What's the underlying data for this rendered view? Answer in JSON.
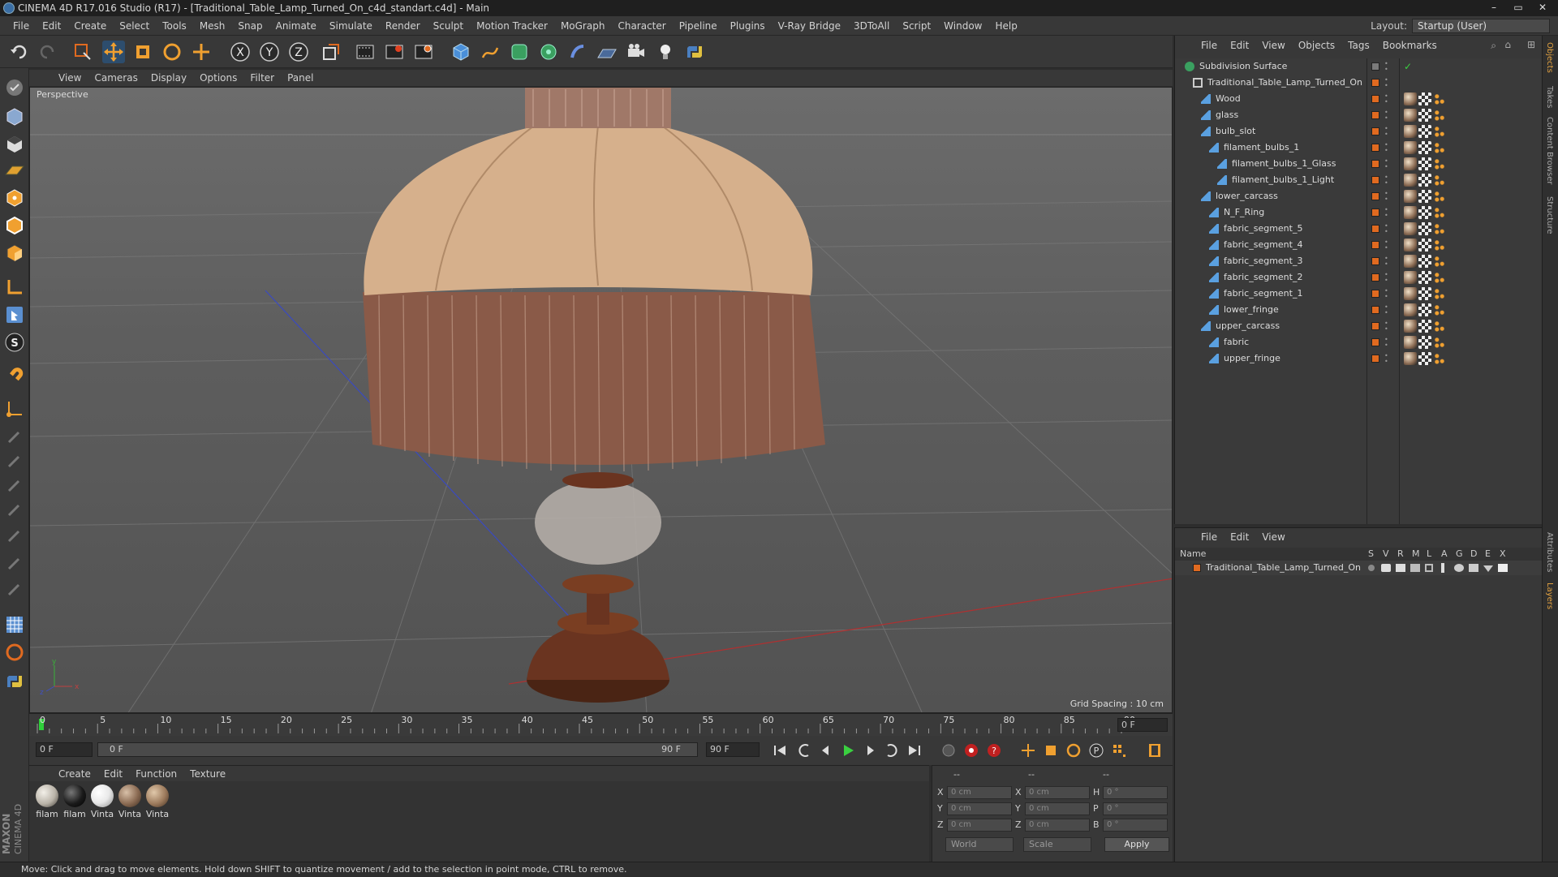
{
  "window": {
    "title": "CINEMA 4D R17.016 Studio (R17) - [Traditional_Table_Lamp_Turned_On_c4d_standart.c4d] - Main",
    "controls": [
      "–",
      "▭",
      "✕"
    ]
  },
  "menubar": {
    "items": [
      "File",
      "Edit",
      "Create",
      "Select",
      "Tools",
      "Mesh",
      "Snap",
      "Animate",
      "Simulate",
      "Render",
      "Sculpt",
      "Motion Tracker",
      "MoGraph",
      "Character",
      "Pipeline",
      "Plugins",
      "V-Ray Bridge",
      "3DToAll",
      "Script",
      "Window",
      "Help"
    ],
    "layout_label": "Layout:",
    "layout_value": "Startup (User)"
  },
  "toolbar": {
    "axis_x": "X",
    "axis_y": "Y",
    "axis_z": "Z"
  },
  "viewport": {
    "menu": [
      "View",
      "Cameras",
      "Display",
      "Options",
      "Filter",
      "Panel"
    ],
    "label": "Perspective",
    "grid_spacing": "Grid Spacing : 10 cm",
    "axis_y": "y",
    "axis_x": "x",
    "axis_z": "z"
  },
  "timeline": {
    "ticks": [
      "0",
      "5",
      "10",
      "15",
      "20",
      "25",
      "30",
      "35",
      "40",
      "45",
      "50",
      "55",
      "60",
      "65",
      "70",
      "75",
      "80",
      "85",
      "90"
    ],
    "current_frame_box": "0 F",
    "start_field": "0 F",
    "range_start": "0 F",
    "range_end": "90 F",
    "end_field": "90 F"
  },
  "material_manager": {
    "menu": [
      "Create",
      "Edit",
      "Function",
      "Texture"
    ],
    "materials": [
      {
        "label": "filam",
        "color": "#b9b3a8"
      },
      {
        "label": "filam",
        "color": "#1a1a1a"
      },
      {
        "label": "Vinta",
        "color": "#e8e8e8"
      },
      {
        "label": "Vinta",
        "color": "#8a6a52"
      },
      {
        "label": "Vinta",
        "color": "#9c7a5c"
      }
    ]
  },
  "coordinates": {
    "header": [
      "--",
      "--",
      "--"
    ],
    "rows": [
      {
        "a": "X",
        "av": "0 cm",
        "b": "X",
        "bv": "0 cm",
        "c": "H",
        "cv": "0 °"
      },
      {
        "a": "Y",
        "av": "0 cm",
        "b": "Y",
        "bv": "0 cm",
        "c": "P",
        "cv": "0 °"
      },
      {
        "a": "Z",
        "av": "0 cm",
        "b": "Z",
        "bv": "0 cm",
        "c": "B",
        "cv": "0 °"
      }
    ],
    "space": "World",
    "mode": "Scale",
    "apply": "Apply"
  },
  "status": "Move: Click and drag to move elements. Hold down SHIFT to quantize movement / add to the selection in point mode, CTRL to remove.",
  "object_manager": {
    "menu": [
      "File",
      "Edit",
      "View",
      "Objects",
      "Tags",
      "Bookmarks"
    ],
    "objects": [
      {
        "name": "Subdivision Surface",
        "depth": 0
      },
      {
        "name": "Traditional_Table_Lamp_Turned_On",
        "depth": 1
      },
      {
        "name": "Wood",
        "depth": 2
      },
      {
        "name": "glass",
        "depth": 2
      },
      {
        "name": "bulb_slot",
        "depth": 2
      },
      {
        "name": "filament_bulbs_1",
        "depth": 3
      },
      {
        "name": "filament_bulbs_1_Glass",
        "depth": 4
      },
      {
        "name": "filament_bulbs_1_Light",
        "depth": 4
      },
      {
        "name": "lower_carcass",
        "depth": 2
      },
      {
        "name": "N_F_Ring",
        "depth": 3
      },
      {
        "name": "fabric_segment_5",
        "depth": 3
      },
      {
        "name": "fabric_segment_4",
        "depth": 3
      },
      {
        "name": "fabric_segment_3",
        "depth": 3
      },
      {
        "name": "fabric_segment_2",
        "depth": 3
      },
      {
        "name": "fabric_segment_1",
        "depth": 3
      },
      {
        "name": "lower_fringe",
        "depth": 3
      },
      {
        "name": "upper_carcass",
        "depth": 2
      },
      {
        "name": "fabric",
        "depth": 3
      },
      {
        "name": "upper_fringe",
        "depth": 3
      }
    ]
  },
  "layer_manager": {
    "menu": [
      "File",
      "Edit",
      "View"
    ],
    "header_name": "Name",
    "columns": [
      "S",
      "V",
      "R",
      "M",
      "L",
      "A",
      "G",
      "D",
      "E",
      "X"
    ],
    "layer": "Traditional_Table_Lamp_Turned_On"
  },
  "side_tabs": [
    "Objects",
    "Takes",
    "Content Browser",
    "Structure",
    "Attributes",
    "Layers"
  ],
  "colors": {
    "accent_orange": "#e06a20",
    "object_icon_blue": "#5aa0e0",
    "timeline_green": "#2fd03a"
  }
}
